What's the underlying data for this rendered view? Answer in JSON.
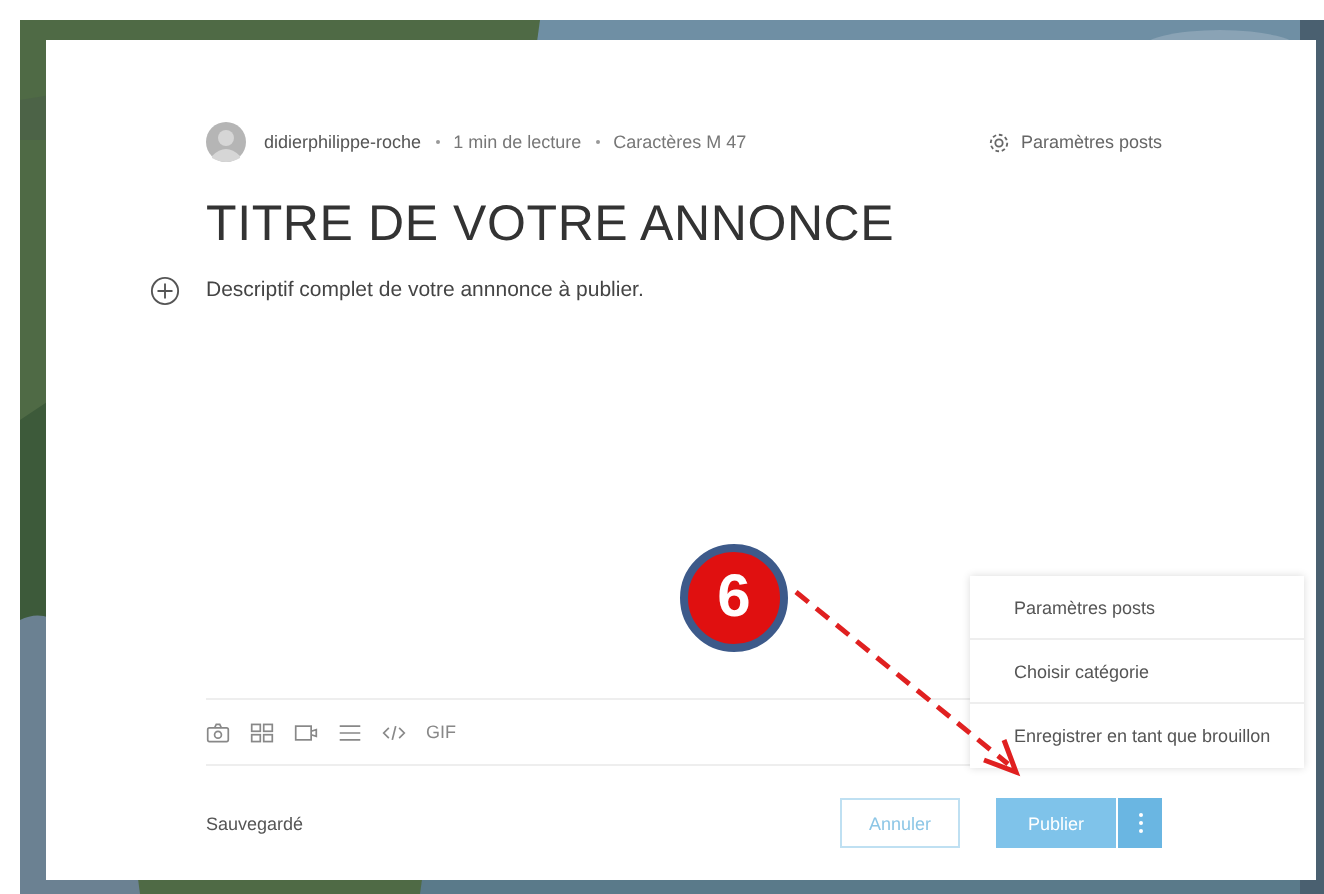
{
  "post": {
    "author": "didierphilippe-roche",
    "read_time": "1 min de lecture",
    "characters": "Caractères M 47",
    "settings_link": "Paramètres posts",
    "title": "TITRE DE VOTRE ANNONCE",
    "description": "Descriptif complet de votre annnonce à publier."
  },
  "toolbar": {
    "gif_label": "GIF"
  },
  "footer": {
    "status": "Sauvegardé",
    "cancel": "Annuler",
    "publish": "Publier"
  },
  "menu": {
    "expanded": true,
    "items": [
      "Paramètres posts",
      "Choisir catégorie",
      "Enregistrer en tant que brouillon"
    ]
  },
  "annotation": {
    "step": "6"
  }
}
